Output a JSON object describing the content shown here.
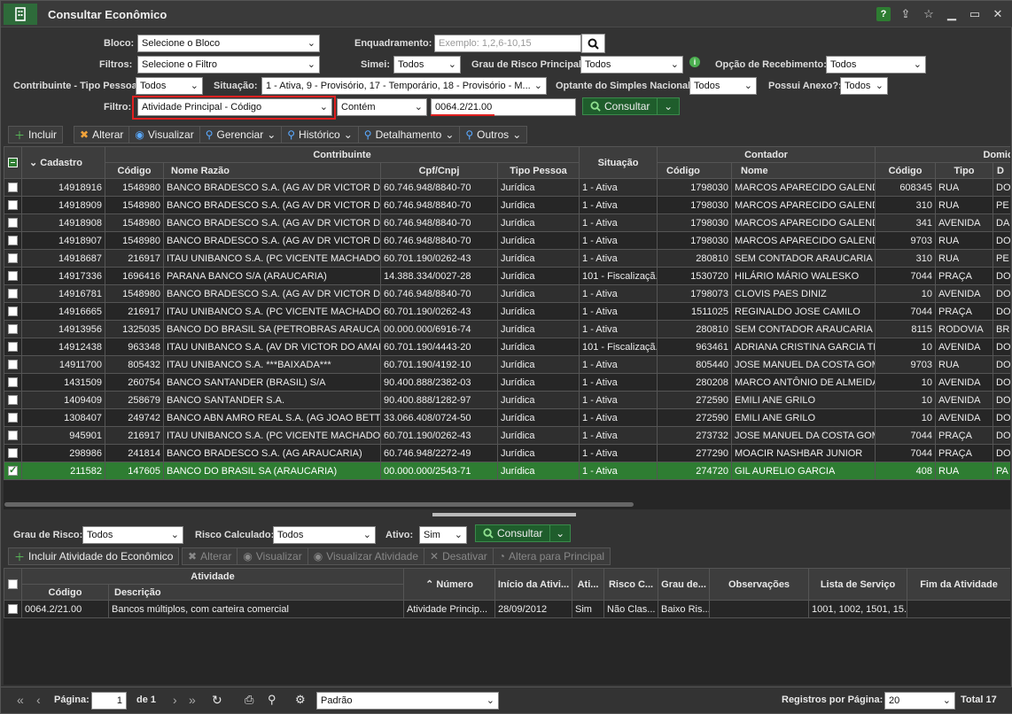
{
  "window": {
    "title": "Consultar Econômico",
    "help": "?"
  },
  "filters": {
    "bloco_label": "Bloco:",
    "bloco_value": "Selecione o Bloco",
    "enquadramento_label": "Enquadramento:",
    "enquadramento_placeholder": "Exemplo: 1,2,6-10,15",
    "filtros_label": "Filtros:",
    "filtros_value": "Selecione o Filtro",
    "simei_label": "Simei:",
    "simei_value": "Todos",
    "grau_risco_label": "Grau de Risco Principal:",
    "grau_risco_value": "Todos",
    "opcao_label": "Opção de Recebimento:",
    "opcao_value": "Todos",
    "tipo_pessoa_label": "Contribuinte - Tipo Pessoa:",
    "tipo_pessoa_value": "Todos",
    "situacao_label": "Situação:",
    "situacao_value": "1 - Ativa, 9 - Provisório, 17 - Temporário, 18 - Provisório - M...",
    "optante_label": "Optante do Simples Nacional:",
    "optante_value": "Todos",
    "anexo_label": "Possui Anexo?:",
    "anexo_value": "Todos",
    "filtro_label": "Filtro:",
    "filtro_value": "Atividade Principal - Código",
    "operador_value": "Contém",
    "filtro_text": "0064.2/21.00",
    "consultar": "Consultar"
  },
  "toolbar": [
    "Incluir",
    "Alterar",
    "Visualizar",
    "Gerenciar",
    "Histórico",
    "Detalhamento",
    "Outros"
  ],
  "grid": {
    "group_headers": {
      "contribuinte": "Contribuinte",
      "situacao": "Situação",
      "contador": "Contador",
      "domicilio": "Domicílio Fisc"
    },
    "headers": {
      "cadastro": "Cadastro",
      "codigo": "Código",
      "nome_razao": "Nome Razão",
      "cpf": "Cpf/Cnpj",
      "tipo_pessoa": "Tipo Pessoa",
      "cont_codigo": "Código",
      "cont_nome": "Nome",
      "dom_codigo": "Código",
      "dom_tipo": "Tipo",
      "dom_d": "D"
    },
    "rows": [
      [
        "14918916",
        "1548980",
        "BANCO BRADESCO S.A. (AG AV DR VICTOR DO A...",
        "60.746.948/8840-70",
        "Jurídica",
        "1 - Ativa",
        "1798030",
        "MARCOS APARECIDO GALENDE",
        "608345",
        "RUA",
        "DO"
      ],
      [
        "14918909",
        "1548980",
        "BANCO BRADESCO S.A. (AG AV DR VICTOR DO A...",
        "60.746.948/8840-70",
        "Jurídica",
        "1 - Ativa",
        "1798030",
        "MARCOS APARECIDO GALENDE",
        "310",
        "RUA",
        "PE"
      ],
      [
        "14918908",
        "1548980",
        "BANCO BRADESCO S.A. (AG AV DR VICTOR DO A...",
        "60.746.948/8840-70",
        "Jurídica",
        "1 - Ativa",
        "1798030",
        "MARCOS APARECIDO GALENDE",
        "341",
        "AVENIDA",
        "DA"
      ],
      [
        "14918907",
        "1548980",
        "BANCO BRADESCO S.A. (AG AV DR VICTOR DO A...",
        "60.746.948/8840-70",
        "Jurídica",
        "1 - Ativa",
        "1798030",
        "MARCOS APARECIDO GALENDE",
        "9703",
        "RUA",
        "DO"
      ],
      [
        "14918687",
        "216917",
        "ITAU UNIBANCO S.A. (PC VICENTE MACHADO AR...",
        "60.701.190/0262-43",
        "Jurídica",
        "1 - Ativa",
        "280810",
        "SEM CONTADOR ARAUCARIA",
        "310",
        "RUA",
        "PE"
      ],
      [
        "14917336",
        "1696416",
        "PARANA BANCO S/A (ARAUCARIA)",
        "14.388.334/0027-28",
        "Jurídica",
        "101 - Fiscalizaçã...",
        "1530720",
        "HILÁRIO MÁRIO WALESKO",
        "7044",
        "PRAÇA",
        "DO"
      ],
      [
        "14916781",
        "1548980",
        "BANCO BRADESCO S.A. (AG AV DR VICTOR DO A...",
        "60.746.948/8840-70",
        "Jurídica",
        "1 - Ativa",
        "1798073",
        "CLOVIS PAES DINIZ",
        "10",
        "AVENIDA",
        "DO"
      ],
      [
        "14916665",
        "216917",
        "ITAU UNIBANCO S.A. (PC VICENTE MACHADO AR...",
        "60.701.190/0262-43",
        "Jurídica",
        "1 - Ativa",
        "1511025",
        "REGINALDO JOSE CAMILO",
        "7044",
        "PRAÇA",
        "DO"
      ],
      [
        "14913956",
        "1325035",
        "BANCO DO BRASIL SA (PETROBRAS ARAUCARIA)",
        "00.000.000/6916-74",
        "Jurídica",
        "1 - Ativa",
        "280810",
        "SEM CONTADOR ARAUCARIA",
        "8115",
        "RODOVIA",
        "BR"
      ],
      [
        "14912438",
        "963348",
        "ITAU UNIBANCO S.A. (AV DR VICTOR DO AMARA...",
        "60.701.190/4443-20",
        "Jurídica",
        "101 - Fiscalizaçã...",
        "963461",
        "ADRIANA CRISTINA GARCIA TR...",
        "10",
        "AVENIDA",
        "DO"
      ],
      [
        "14911700",
        "805432",
        "ITAU UNIBANCO S.A. ***BAIXADA***",
        "60.701.190/4192-10",
        "Jurídica",
        "1 - Ativa",
        "805440",
        "JOSE MANUEL DA COSTA GOM...",
        "9703",
        "RUA",
        "DO"
      ],
      [
        "1431509",
        "260754",
        "BANCO SANTANDER (BRASIL) S/A",
        "90.400.888/2382-03",
        "Jurídica",
        "1 - Ativa",
        "280208",
        "MARCO ANTÔNIO DE ALMEIDA",
        "10",
        "AVENIDA",
        "DO"
      ],
      [
        "1409409",
        "258679",
        "BANCO SANTANDER S.A.",
        "90.400.888/1282-97",
        "Jurídica",
        "1 - Ativa",
        "272590",
        "EMILI ANE GRILO",
        "10",
        "AVENIDA",
        "DO"
      ],
      [
        "1308407",
        "249742",
        "BANCO ABN AMRO REAL S.A. (AG JOAO BETTEG...",
        "33.066.408/0724-50",
        "Jurídica",
        "1 - Ativa",
        "272590",
        "EMILI ANE GRILO",
        "10",
        "AVENIDA",
        "DO"
      ],
      [
        "945901",
        "216917",
        "ITAU UNIBANCO S.A. (PC VICENTE MACHADO AR...",
        "60.701.190/0262-43",
        "Jurídica",
        "1 - Ativa",
        "273732",
        "JOSE MANUEL DA COSTA GOM...",
        "7044",
        "PRAÇA",
        "DO"
      ],
      [
        "298986",
        "241814",
        "BANCO BRADESCO S.A. (AG ARAUCARIA)",
        "60.746.948/2272-49",
        "Jurídica",
        "1 - Ativa",
        "277290",
        "MOACIR NASHBAR JUNIOR",
        "7044",
        "PRAÇA",
        "DO"
      ],
      [
        "211582",
        "147605",
        "BANCO DO BRASIL SA (ARAUCARIA)",
        "00.000.000/2543-71",
        "Jurídica",
        "1 - Ativa",
        "274720",
        "GIL AURELIO GARCIA",
        "408",
        "RUA",
        "PA"
      ]
    ]
  },
  "lower_filters": {
    "grau_label": "Grau de Risco:",
    "grau_value": "Todos",
    "risco_label": "Risco Calculado:",
    "risco_value": "Todos",
    "ativo_label": "Ativo:",
    "ativo_value": "Sim",
    "consultar": "Consultar"
  },
  "lower_toolbar": [
    "Incluir Atividade do Econômico",
    "Alterar",
    "Visualizar",
    "Visualizar Atividade",
    "Desativar",
    "Altera para Principal"
  ],
  "activity_grid": {
    "group_header": "Atividade",
    "headers": {
      "codigo": "Código",
      "descricao": "Descrição",
      "numero": "Número",
      "inicio": "Início da Ativi...",
      "ati": "Ati...",
      "risco": "Risco C...",
      "grau": "Grau de...",
      "obs": "Observações",
      "lista": "Lista de Serviço",
      "fim": "Fim da Atividade"
    },
    "rows": [
      [
        "0064.2/21.00",
        "Bancos múltiplos, com carteira comercial",
        "Atividade Princip...",
        "28/09/2012",
        "Sim",
        "Não Clas...",
        "Baixo Ris...",
        "",
        "1001, 1002, 1501, 15...",
        ""
      ]
    ]
  },
  "footer": {
    "pagina_label": "Página:",
    "pagina_value": "1",
    "de": "de 1",
    "layout_value": "Padrão",
    "registros_label": "Registros por Página:",
    "registros_value": "20",
    "total": "Total 17"
  }
}
